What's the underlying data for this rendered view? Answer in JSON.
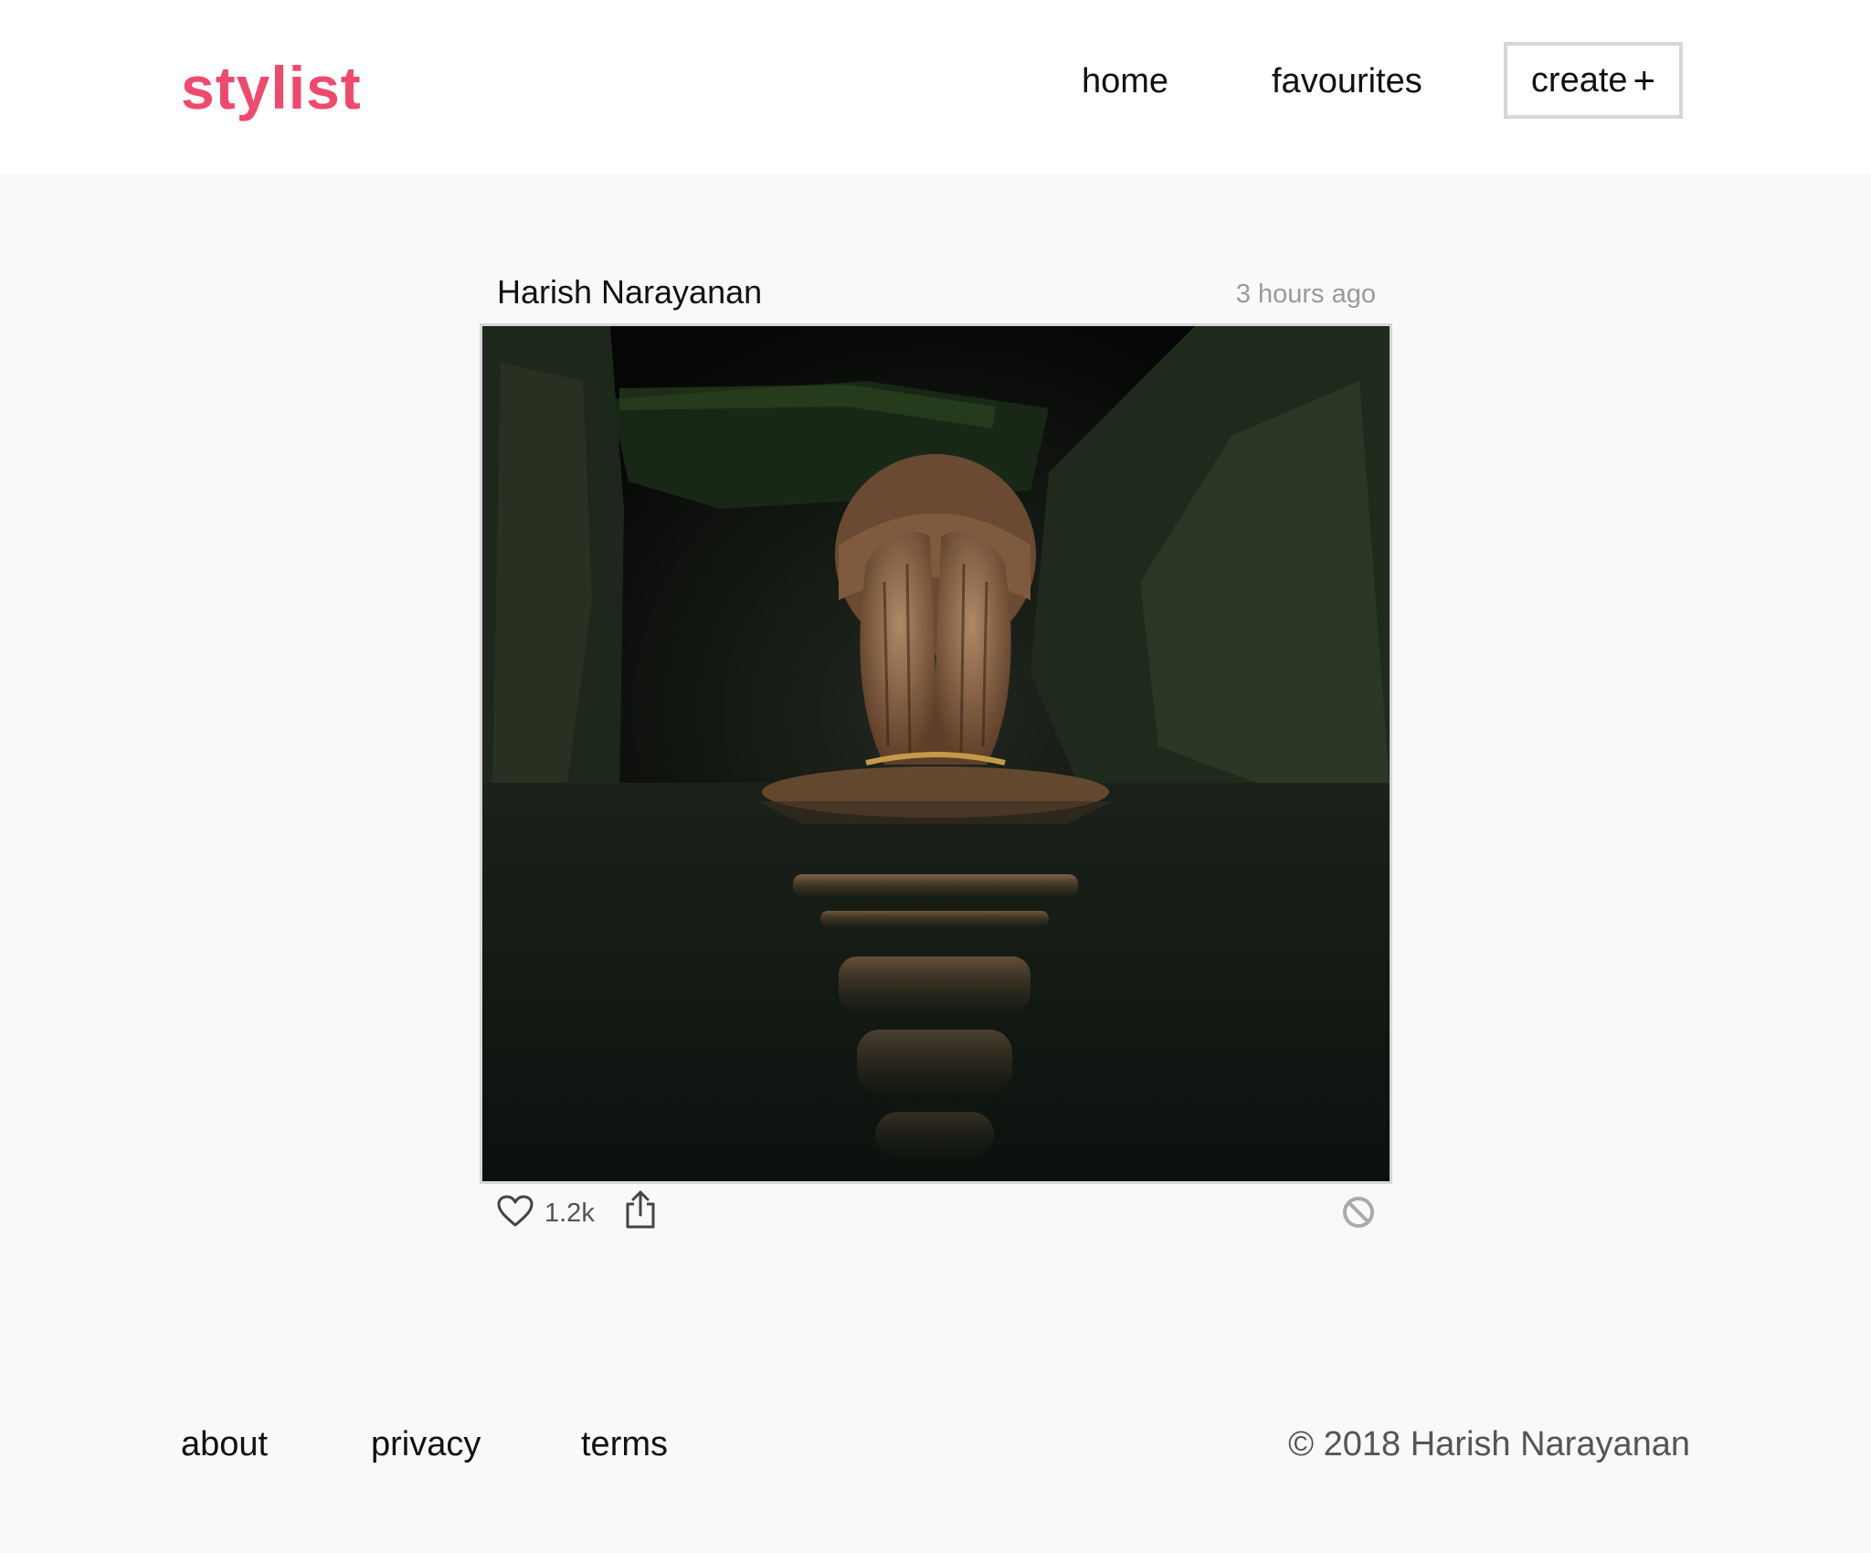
{
  "header": {
    "logo": "stylist",
    "nav": {
      "home": "home",
      "favourites": "favourites",
      "create": "create",
      "create_symbol": "+"
    }
  },
  "post": {
    "author": "Harish Narayanan",
    "time": "3 hours ago",
    "likes": "1.2k",
    "icons": {
      "like": "heart-outline-icon",
      "share": "share-icon",
      "block": "block-icon"
    }
  },
  "footer": {
    "links": {
      "about": "about",
      "privacy": "privacy",
      "terms": "terms"
    },
    "copyright": "© 2018 Harish Narayanan"
  },
  "colors": {
    "brand": "#ef4a6e",
    "page_background": "#f9f9f9",
    "header_background": "#ffffff"
  }
}
